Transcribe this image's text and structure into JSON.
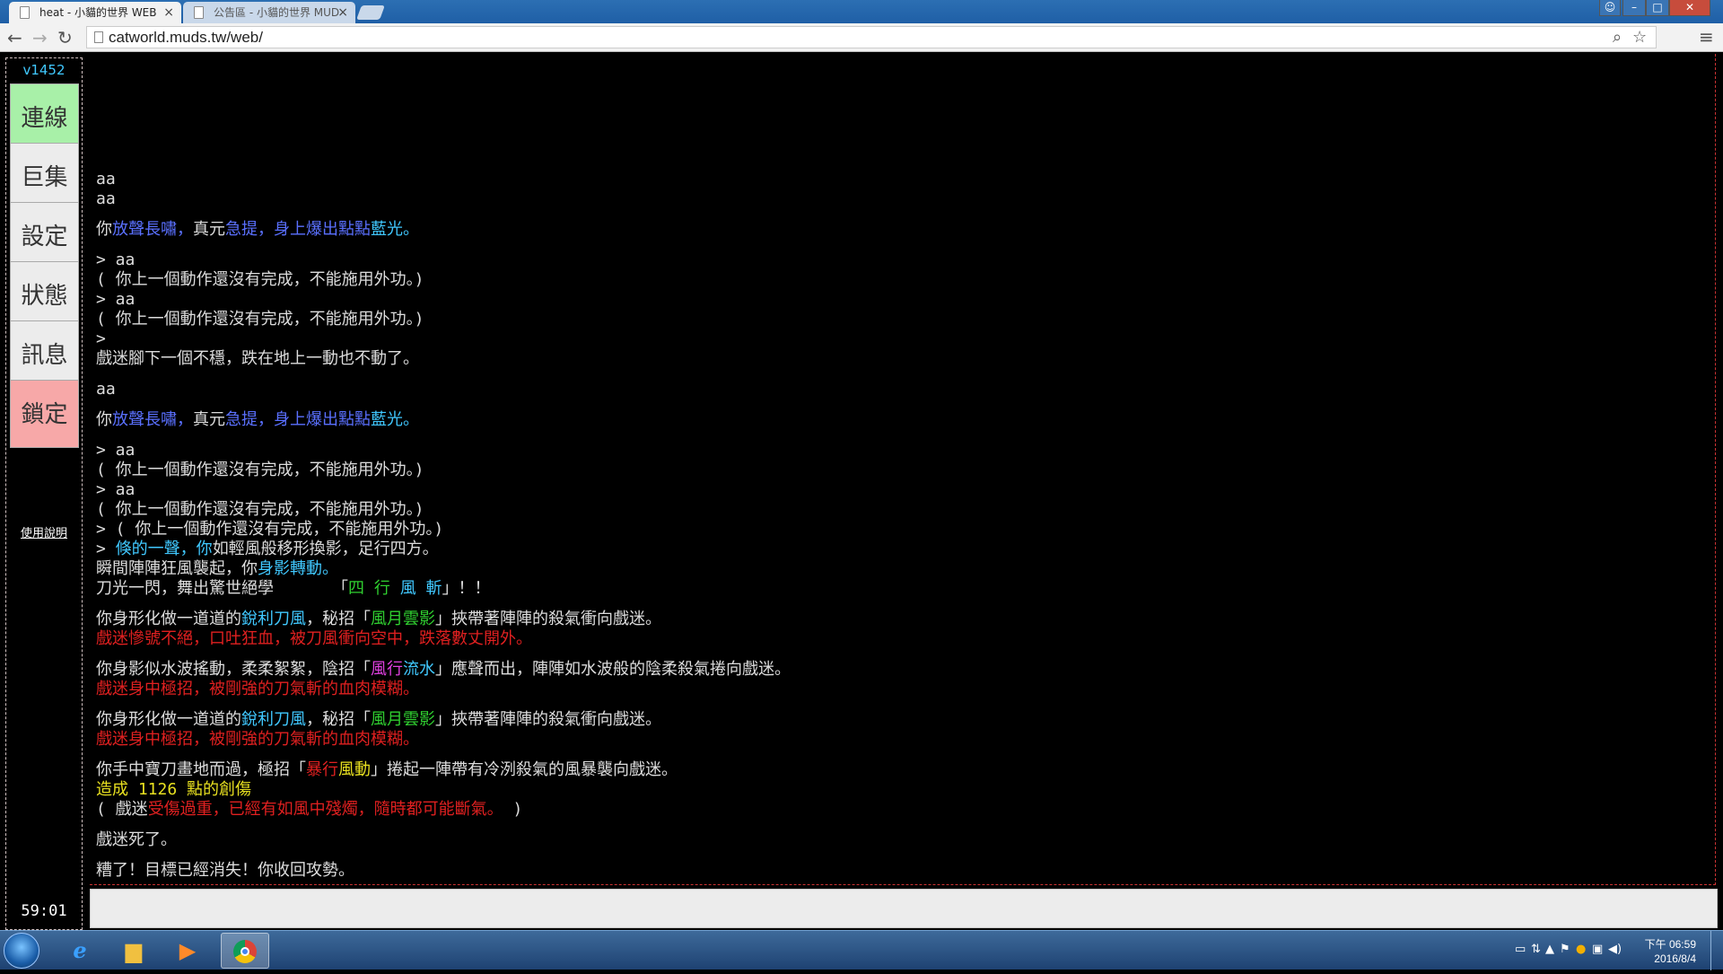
{
  "browser": {
    "tabs": [
      {
        "title": "heat - 小貓的世界 WEB",
        "active": true
      },
      {
        "title": "公告區 - 小貓的世界 MUD",
        "active": false
      }
    ],
    "url": "catworld.muds.tw/web/"
  },
  "client": {
    "version": "v1452",
    "buttons": [
      {
        "label": "連線",
        "color": "#a8f0a8"
      },
      {
        "label": "巨集",
        "color": "#ececec"
      },
      {
        "label": "設定",
        "color": "#ececec"
      },
      {
        "label": "狀態",
        "color": "#ececec"
      },
      {
        "label": "訊息",
        "color": "#ececec"
      },
      {
        "label": "鎖定",
        "color": "#f7a8a8"
      }
    ],
    "help_link": "使用說明",
    "timer": "59:01",
    "input_value": "",
    "colors": {
      "white": "#dddddd",
      "cyan": "#40c8ff",
      "blue": "#5a70ff",
      "green": "#30d030",
      "red": "#e02020",
      "yellow": "#e8e020",
      "magenta": "#e040e0"
    },
    "output_lines": [
      [
        {
          "t": "aa",
          "c": "white"
        }
      ],
      [
        {
          "t": "aa",
          "c": "white"
        }
      ],
      [],
      [
        {
          "t": "你",
          "c": "white"
        },
        {
          "t": "放聲長嘯，",
          "c": "blue"
        },
        {
          "t": "真元",
          "c": "white"
        },
        {
          "t": "急提，",
          "c": "blue"
        },
        {
          "t": "身上爆出點點",
          "c": "blue"
        },
        {
          "t": "藍光。",
          "c": "cyan"
        }
      ],
      [],
      [
        {
          "t": "> aa",
          "c": "white"
        }
      ],
      [
        {
          "t": "( 你上一個動作還沒有完成，不能施用外功。)",
          "c": "white"
        }
      ],
      [
        {
          "t": "> aa",
          "c": "white"
        }
      ],
      [
        {
          "t": "( 你上一個動作還沒有完成，不能施用外功。)",
          "c": "white"
        }
      ],
      [
        {
          "t": ">",
          "c": "white"
        }
      ],
      [
        {
          "t": "戲迷腳下一個不穩，跌在地上一動也不動了。",
          "c": "white"
        }
      ],
      [],
      [
        {
          "t": "aa",
          "c": "white"
        }
      ],
      [],
      [
        {
          "t": "你",
          "c": "white"
        },
        {
          "t": "放聲長嘯，",
          "c": "blue"
        },
        {
          "t": "真元",
          "c": "white"
        },
        {
          "t": "急提，",
          "c": "blue"
        },
        {
          "t": "身上爆出點點",
          "c": "blue"
        },
        {
          "t": "藍光。",
          "c": "cyan"
        }
      ],
      [],
      [
        {
          "t": "> aa",
          "c": "white"
        }
      ],
      [
        {
          "t": "( 你上一個動作還沒有完成，不能施用外功。)",
          "c": "white"
        }
      ],
      [
        {
          "t": "> aa",
          "c": "white"
        }
      ],
      [
        {
          "t": "( 你上一個動作還沒有完成，不能施用外功。)",
          "c": "white"
        }
      ],
      [
        {
          "t": "> ( 你上一個動作還沒有完成，不能施用外功。)",
          "c": "white"
        }
      ],
      [
        {
          "t": "> ",
          "c": "white"
        },
        {
          "t": "倏的一聲，你",
          "c": "cyan"
        },
        {
          "t": "如輕風般移形換影，足行四方。",
          "c": "white"
        }
      ],
      [
        {
          "t": "瞬間陣陣狂風襲起，你",
          "c": "white"
        },
        {
          "t": "身影轉動。",
          "c": "cyan"
        }
      ],
      [
        {
          "t": "刀光一閃，舞出驚世絕學      「",
          "c": "white"
        },
        {
          "t": "四 行 ",
          "c": "green"
        },
        {
          "t": "風 斬",
          "c": "cyan"
        },
        {
          "t": "」！！",
          "c": "white"
        }
      ],
      [],
      [
        {
          "t": "你身形化做一道道的",
          "c": "white"
        },
        {
          "t": "銳利刀風",
          "c": "cyan"
        },
        {
          "t": "，秘招「",
          "c": "white"
        },
        {
          "t": "風月雲影",
          "c": "green"
        },
        {
          "t": "」挾帶著陣陣的殺氣衝向戲迷。",
          "c": "white"
        }
      ],
      [
        {
          "t": "戲迷慘號不絕，口吐狂血，被刀風衝向空中，跌落數丈開外。",
          "c": "red"
        }
      ],
      [],
      [
        {
          "t": "你身影似水波搖動，柔柔絮絮，陰招「",
          "c": "white"
        },
        {
          "t": "風行",
          "c": "magenta"
        },
        {
          "t": "流水",
          "c": "cyan"
        },
        {
          "t": "」應聲而出，陣陣如水波般的陰柔殺氣捲向戲迷。",
          "c": "white"
        }
      ],
      [
        {
          "t": "戲迷身中極招，被剛強的刀氣斬的血肉模糊。",
          "c": "red"
        }
      ],
      [],
      [
        {
          "t": "你身形化做一道道的",
          "c": "white"
        },
        {
          "t": "銳利刀風",
          "c": "cyan"
        },
        {
          "t": "，秘招「",
          "c": "white"
        },
        {
          "t": "風月雲影",
          "c": "green"
        },
        {
          "t": "」挾帶著陣陣的殺氣衝向戲迷。",
          "c": "white"
        }
      ],
      [
        {
          "t": "戲迷身中極招，被剛強的刀氣斬的血肉模糊。",
          "c": "red"
        }
      ],
      [],
      [
        {
          "t": "你手中寶刀畫地而過，極招「",
          "c": "white"
        },
        {
          "t": "暴行",
          "c": "red"
        },
        {
          "t": "風動",
          "c": "yellow"
        },
        {
          "t": "」捲起一陣帶有冷洌殺氣的風暴襲向戲迷。",
          "c": "white"
        }
      ],
      [
        {
          "t": "造成 1126 點的創傷",
          "c": "yellow"
        }
      ],
      [
        {
          "t": "( 戲迷",
          "c": "white"
        },
        {
          "t": "受傷過重，已經有如風中殘燭，隨時都可能斷氣。",
          "c": "red"
        },
        {
          "t": " )",
          "c": "white"
        }
      ],
      [],
      [
        {
          "t": "戲迷死了。",
          "c": "white"
        }
      ],
      [],
      [
        {
          "t": "糟了！目標已經消失！你收回攻勢。",
          "c": "white"
        }
      ]
    ]
  },
  "taskbar": {
    "apps": [
      {
        "icon": "internet-explorer-icon",
        "active": false
      },
      {
        "icon": "folder-icon",
        "active": false
      },
      {
        "icon": "media-player-icon",
        "active": false
      },
      {
        "icon": "chrome-icon",
        "active": true
      }
    ],
    "clock_time": "下午 06:59",
    "clock_date": "2016/8/4"
  }
}
